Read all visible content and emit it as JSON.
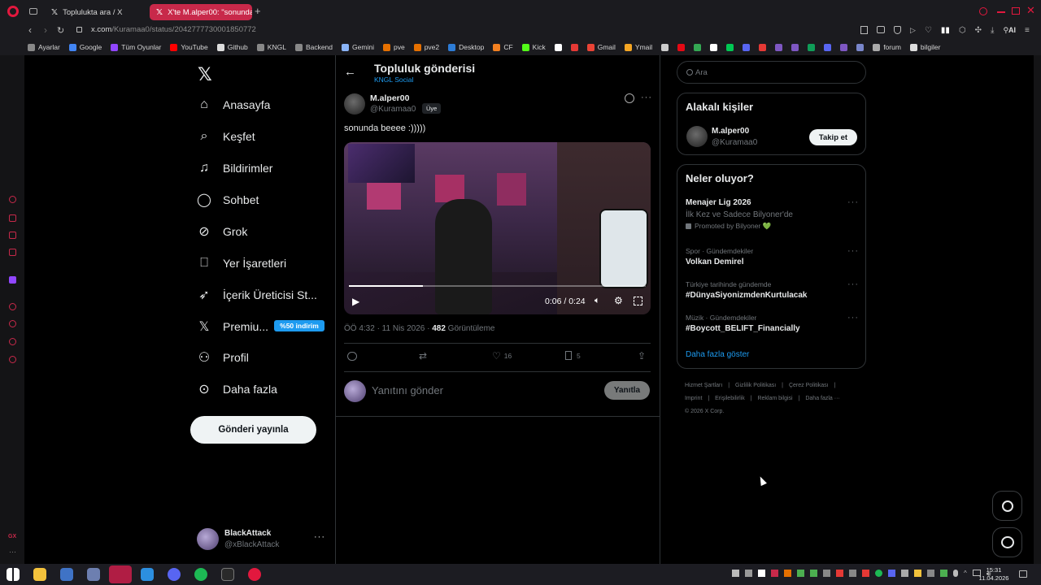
{
  "browser": {
    "tabs": [
      {
        "label": "Toplulukta ara / X",
        "active": false
      },
      {
        "label": "X'te M.alper00: \"sonunda",
        "active": true
      }
    ],
    "url_host": "x.com",
    "url_path": "/Kuramaa0/status/2042777730001850772",
    "bookmarks": [
      {
        "label": "Ayarlar",
        "color": "#888888"
      },
      {
        "label": "Google",
        "color": "#4285f4"
      },
      {
        "label": "Tüm Oyunlar",
        "color": "#9146ff"
      },
      {
        "label": "YouTube",
        "color": "#ff0000"
      },
      {
        "label": "Github",
        "color": "#dddddd"
      },
      {
        "label": "KNGL",
        "color": "#888888"
      },
      {
        "label": "Backend",
        "color": "#888888"
      },
      {
        "label": "Gemini",
        "color": "#8ab4f8"
      },
      {
        "label": "pve",
        "color": "#e57000"
      },
      {
        "label": "pve2",
        "color": "#e57000"
      },
      {
        "label": "Desktop",
        "color": "#2d7cd6"
      },
      {
        "label": "CF",
        "color": "#f38020"
      },
      {
        "label": "Kick",
        "color": "#53fc18"
      },
      {
        "label": "",
        "color": "#ffffff"
      },
      {
        "label": "",
        "color": "#e53935"
      },
      {
        "label": "Gmail",
        "color": "#ea4335"
      },
      {
        "label": "Ymail",
        "color": "#f5a623"
      },
      {
        "label": "",
        "color": "#cccccc"
      },
      {
        "label": "",
        "color": "#e50914"
      },
      {
        "label": "",
        "color": "#34a853"
      },
      {
        "label": "",
        "color": "#ffffff"
      },
      {
        "label": "",
        "color": "#00c853"
      },
      {
        "label": "",
        "color": "#5865f2"
      },
      {
        "label": "",
        "color": "#e53935"
      },
      {
        "label": "",
        "color": "#7e57c2"
      },
      {
        "label": "",
        "color": "#7e57c2"
      },
      {
        "label": "",
        "color": "#0f9d58"
      },
      {
        "label": "",
        "color": "#5865f2"
      },
      {
        "label": "",
        "color": "#7e57c2"
      },
      {
        "label": "",
        "color": "#7986cb"
      },
      {
        "label": "forum",
        "color": "#aaaaaa"
      },
      {
        "label": "bilgiler",
        "color": "#dddddd"
      }
    ]
  },
  "nav": {
    "items": [
      {
        "label": "Anasayfa",
        "icon": "home-icon"
      },
      {
        "label": "Keşfet",
        "icon": "search-icon"
      },
      {
        "label": "Bildirimler",
        "icon": "bell-icon"
      },
      {
        "label": "Sohbet",
        "icon": "chat-icon"
      },
      {
        "label": "Grok",
        "icon": "grok-icon"
      },
      {
        "label": "Yer İşaretleri",
        "icon": "bookmark-icon"
      },
      {
        "label": "İçerik Üreticisi St...",
        "icon": "rocket-icon"
      },
      {
        "label": "Premiu...",
        "icon": "x-icon"
      },
      {
        "label": "Profil",
        "icon": "person-icon"
      },
      {
        "label": "Daha fazla",
        "icon": "more-circle-icon"
      }
    ],
    "premium_badge": "%50 indirim",
    "post_button": "Gönderi yayınla",
    "account": {
      "name": "BlackAttack",
      "handle": "@xBlackAttack"
    }
  },
  "post": {
    "header_title": "Topluluk gönderisi",
    "header_sub": "KNGL Social",
    "author_name": "M.alper00",
    "author_handle": "@Kuramaa0",
    "member_badge": "Üye",
    "text": "sonunda beeee :)))))",
    "video_time": "0:06 / 0:24",
    "video_progress": 0.25,
    "meta_time": "ÖÖ 4:32 · 11 Nis 2026 · ",
    "meta_views": "482",
    "meta_views_label": " Görüntüleme",
    "likes": "16",
    "bookmarks": "5",
    "reply_placeholder": "Yanıtını gönder",
    "reply_button": "Yanıtla"
  },
  "right": {
    "search_placeholder": "Ara",
    "related_title": "Alakalı kişiler",
    "related_name": "M.alper00",
    "related_handle": "@Kuramaa0",
    "follow_button": "Takip et",
    "trends_title": "Neler oluyor?",
    "promo_title": "Menajer Lig 2026",
    "promo_sub": "İlk Kez ve Sadece Bilyoner'de",
    "promo_by": "Promoted by Bilyoner 💚",
    "trends": [
      {
        "category": "Spor · Gündemdekiler",
        "name": "Volkan Demirel"
      },
      {
        "category": "Türkiye tarihinde gündemde",
        "name": "#DünyaSiyonizmdenKurtulacak"
      },
      {
        "category": "Müzik · Gündemdekiler",
        "name": "#Boycott_BELIFT_Financially"
      }
    ],
    "show_more": "Daha fazla göster",
    "footer_links": [
      "Hizmet Şartları",
      "Gizlilik Politikası",
      "Çerez Politikası",
      "Imprint",
      "Erişilebilirlik",
      "Reklam bilgisi",
      "Daha fazla ···"
    ],
    "copyright": "© 2026 X Corp."
  },
  "taskbar": {
    "time": "15:31",
    "date": "11.04.2026"
  }
}
